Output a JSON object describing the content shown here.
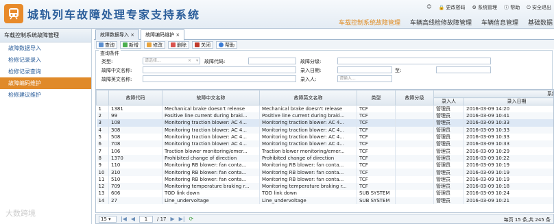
{
  "app": {
    "title": "城轨列车故障处理专家支持系统"
  },
  "toplinks": [
    "更改密码",
    "系统管理",
    "帮助",
    "安全退出"
  ],
  "topnav": [
    "车载控制系统故障管理",
    "车辆高线检修故障管理",
    "车辆信息管理",
    "基础数据"
  ],
  "sidebar": {
    "title": "车载控制系统故障管理",
    "items": [
      "故障数据导入",
      "检修记录录入",
      "检修记录查询",
      "故障编码维护",
      "检修建议维护"
    ],
    "active_index": 3
  },
  "tabs": [
    "故障数据导入",
    "故障编码维护"
  ],
  "toolbar": [
    "查询",
    "新增",
    "修改",
    "删除",
    "关闭",
    "帮助"
  ],
  "query": {
    "legend": "查询条件",
    "type_label": "类型:",
    "type_value": "请选择...",
    "code_label": "故障代码:",
    "level_label": "故障分级:",
    "cn_label": "故障中文名称:",
    "date_label": "录入日期:",
    "to_label": "至:",
    "en_label": "故障英文名称:",
    "person_label": "录入人:",
    "person_placeholder": "请输入..."
  },
  "grid": {
    "group_header": "系统信息",
    "headers": [
      "故障代码",
      "故障中文名称",
      "故障英文名称",
      "类型",
      "故障分级",
      "录入人",
      "录入日期"
    ],
    "rows": [
      {
        "n": "1",
        "code": "1381",
        "cn": "Mechanical brake doesn't release",
        "en": "Mechanical brake doesn't release",
        "type": "TCF",
        "level": "",
        "person": "管理员",
        "date": "2016-03-09 14:20"
      },
      {
        "n": "2",
        "code": "99",
        "cn": "Positive line current during braki...",
        "en": "Positive line current during braki...",
        "type": "TCF",
        "level": "",
        "person": "管理员",
        "date": "2016-03-09 10:41"
      },
      {
        "n": "3",
        "code": "108",
        "cn": "Monitoring traction blower: AC 4...",
        "en": "Monitoring traction blower: AC 4...",
        "type": "TCF",
        "level": "",
        "person": "管理员",
        "date": "2016-03-09 10:33"
      },
      {
        "n": "4",
        "code": "308",
        "cn": "Monitoring traction blower: AC 4...",
        "en": "Monitoring traction blower: AC 4...",
        "type": "TCF",
        "level": "",
        "person": "管理员",
        "date": "2016-03-09 10:33"
      },
      {
        "n": "5",
        "code": "508",
        "cn": "Monitoring traction blower: AC 4...",
        "en": "Monitoring traction blower: AC 4...",
        "type": "TCF",
        "level": "",
        "person": "管理员",
        "date": "2016-03-09 10:33"
      },
      {
        "n": "6",
        "code": "708",
        "cn": "Monitoring traction blower: AC 4...",
        "en": "Monitoring traction blower: AC 4...",
        "type": "TCF",
        "level": "",
        "person": "管理员",
        "date": "2016-03-09 10:33"
      },
      {
        "n": "7",
        "code": "106",
        "cn": "Traction blower monitoring/emer...",
        "en": "Traction blower monitoring/emer...",
        "type": "TCF",
        "level": "",
        "person": "管理员",
        "date": "2016-03-09 10:29"
      },
      {
        "n": "8",
        "code": "1370",
        "cn": "Prohibited change of direction",
        "en": "Prohibited change of direction",
        "type": "TCF",
        "level": "",
        "person": "管理员",
        "date": "2016-03-09 10:22"
      },
      {
        "n": "9",
        "code": "110",
        "cn": "Monitoring RB blower: fan conta...",
        "en": "Monitoring RB blower: fan conta...",
        "type": "TCF",
        "level": "",
        "person": "管理员",
        "date": "2016-03-09 10:19"
      },
      {
        "n": "10",
        "code": "310",
        "cn": "Monitoring RB blower: fan conta...",
        "en": "Monitoring RB blower: fan conta...",
        "type": "TCF",
        "level": "",
        "person": "管理员",
        "date": "2016-03-09 10:19"
      },
      {
        "n": "11",
        "code": "510",
        "cn": "Monitoring RB blower: fan conta...",
        "en": "Monitoring RB blower: fan conta...",
        "type": "TCF",
        "level": "",
        "person": "管理员",
        "date": "2016-03-09 10:19"
      },
      {
        "n": "12",
        "code": "709",
        "cn": "Monitoring temperature braking r...",
        "en": "Monitoring temperature braking r...",
        "type": "TCF",
        "level": "",
        "person": "管理员",
        "date": "2016-03-09 10:18"
      },
      {
        "n": "13",
        "code": "606",
        "cn": "TOD link down",
        "en": "TOD link down",
        "type": "SUB SYSTEM",
        "level": "",
        "person": "管理员",
        "date": "2016-03-09 10:24"
      },
      {
        "n": "14",
        "code": "27",
        "cn": "Line_undervoltage",
        "en": "Line_undervoltage",
        "type": "SUB SYSTEM",
        "level": "",
        "person": "管理员",
        "date": "2016-03-09 10:21"
      }
    ],
    "selected_index": 2
  },
  "pager": {
    "page_size": "15",
    "current_page": "1",
    "total_pages": "/ 17",
    "info": "每页 15 条,共 245 条"
  },
  "watermark": "大数跨境"
}
